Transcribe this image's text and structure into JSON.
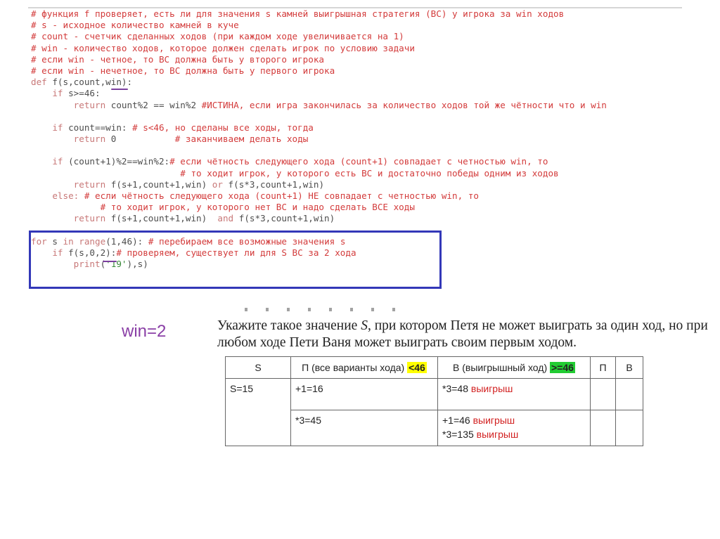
{
  "code_lines": [
    [
      {
        "t": "# функция f проверяет, есть ли для значения s камней выигрышная стратегия (ВС) у игрока за win ходов",
        "c": "c"
      }
    ],
    [
      {
        "t": "# s - исходное количество камней в куче",
        "c": "c"
      }
    ],
    [
      {
        "t": "# count - счетчик сделанных ходов (при каждом ходе увеличивается на 1)",
        "c": "c"
      }
    ],
    [
      {
        "t": "# win - количество ходов, которое должен сделать игрок по условию задачи",
        "c": "c"
      }
    ],
    [
      {
        "t": "# если win - четное, то ВС должна быть у второго игрока",
        "c": "c"
      }
    ],
    [
      {
        "t": "# если win - нечетное, то ВС должна быть у первого игрока",
        "c": "c"
      }
    ],
    [
      {
        "t": "def ",
        "c": "k"
      },
      {
        "t": "f(s,count,win):",
        "c": "t"
      }
    ],
    [
      {
        "t": "    if ",
        "c": "k"
      },
      {
        "t": "s>=46:",
        "c": "t"
      }
    ],
    [
      {
        "t": "        return ",
        "c": "k"
      },
      {
        "t": "count%2 == win%2 ",
        "c": "t"
      },
      {
        "t": "#ИСТИНА, если игра закончилась за количество ходов той же чётности что и win",
        "c": "c"
      }
    ],
    [
      {
        "t": "",
        "c": "t"
      }
    ],
    [
      {
        "t": "    if ",
        "c": "k"
      },
      {
        "t": "count==win: ",
        "c": "t"
      },
      {
        "t": "# s<46, но сделаны все ходы, тогда",
        "c": "c"
      }
    ],
    [
      {
        "t": "        return ",
        "c": "k"
      },
      {
        "t": "0           ",
        "c": "t"
      },
      {
        "t": "# заканчиваем делать ходы",
        "c": "c"
      }
    ],
    [
      {
        "t": "",
        "c": "t"
      }
    ],
    [
      {
        "t": "    if ",
        "c": "k"
      },
      {
        "t": "(count+1)%2==win%2:",
        "c": "t"
      },
      {
        "t": "# если чётность следующего хода (count+1) совпадает с четностью win, то",
        "c": "c"
      }
    ],
    [
      {
        "t": "                            # то ходит игрок, у которого есть ВС и достаточно победы одним из ходов",
        "c": "c"
      }
    ],
    [
      {
        "t": "        return ",
        "c": "k"
      },
      {
        "t": "f(s+1,count+1,win) ",
        "c": "t"
      },
      {
        "t": "or ",
        "c": "k"
      },
      {
        "t": "f(s*3,count+1,win)",
        "c": "t"
      }
    ],
    [
      {
        "t": "    else: ",
        "c": "k"
      },
      {
        "t": "# если чётность следующего хода (count+1) НЕ совпадает с четностью win, то",
        "c": "c"
      }
    ],
    [
      {
        "t": "             # то ходит игрок, у которого нет ВС и надо сделать ВСЕ ходы",
        "c": "c"
      }
    ],
    [
      {
        "t": "        return ",
        "c": "k"
      },
      {
        "t": "f(s+1,count+1,win)  ",
        "c": "t"
      },
      {
        "t": "and ",
        "c": "k"
      },
      {
        "t": "f(s*3,count+1,win)",
        "c": "t"
      }
    ],
    [
      {
        "t": "",
        "c": "t"
      }
    ],
    [
      {
        "t": "for ",
        "c": "k"
      },
      {
        "t": "s ",
        "c": "t"
      },
      {
        "t": "in range",
        "c": "k"
      },
      {
        "t": "(1,46): ",
        "c": "t"
      },
      {
        "t": "# перебираем все возможные значения s",
        "c": "c"
      }
    ],
    [
      {
        "t": "    if ",
        "c": "k"
      },
      {
        "t": "f(s,0,2):",
        "c": "t"
      },
      {
        "t": "# проверяем, существует ли для S ВС за 2 хода",
        "c": "c"
      }
    ],
    [
      {
        "t": "        print",
        "c": "k"
      },
      {
        "t": "(",
        "c": "t"
      },
      {
        "t": "'19'",
        "c": "s"
      },
      {
        "t": "),s)",
        "c": "t"
      }
    ]
  ],
  "win_note": "win=2",
  "task_text_1": "Укажите такое значение ",
  "task_text_var": "S",
  "task_text_2": ", при котором Петя не может выиграть за один ход, но при любом ходе Пети Ваня может выиграть своим первым ходом.",
  "table": {
    "headers": {
      "s": "S",
      "p_pre": "П (все варианты хода) ",
      "p_hl": "<46",
      "v_pre": "В (выигрышный ход) ",
      "v_hl": ">=46",
      "p": "П",
      "v": "В"
    },
    "s_value": "S=15",
    "row1_move": "+1=16",
    "row1_reply": "*3=48",
    "row2_move": "*3=45",
    "row2_reply_1": "+1=46",
    "row2_reply_2": "*3=135",
    "win_word": "выигрыш"
  }
}
